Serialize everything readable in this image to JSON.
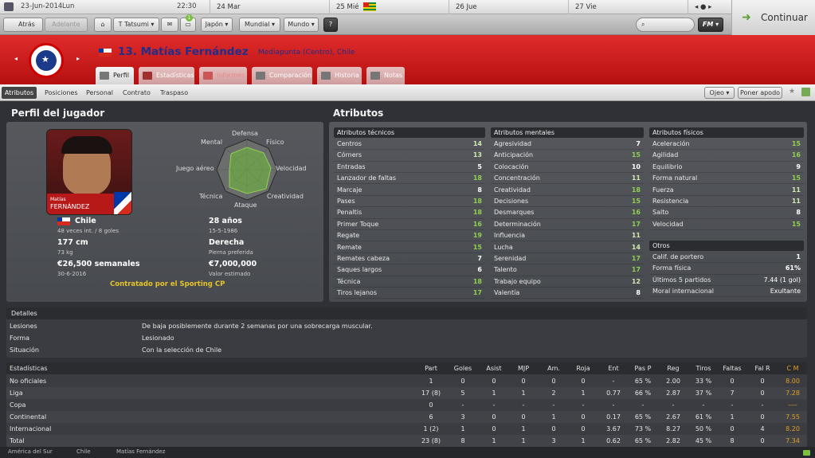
{
  "calendar": {
    "date": "23-Jun-2014",
    "day": "Lun",
    "time": "22:30",
    "d1": "24 Mar",
    "d2": "25 Mié",
    "d3": "26 Jue",
    "d4": "27 Vie"
  },
  "nav": {
    "back": "Atrás",
    "forward": "Adelante",
    "manager": "T Tatsumi",
    "menu1": "Japón",
    "menu2": "Mundial",
    "menu3": "Mundo",
    "help": "?",
    "search_placeholder": "",
    "fm": "FM",
    "continue": "Continuar",
    "notif": "1"
  },
  "player": {
    "title": "13. Matías Fernández",
    "position": "Mediapunta (Centro), Chile"
  },
  "tabs": [
    "Perfil",
    "Estadísticas",
    "Informes",
    "Comparación",
    "Historia",
    "Notas"
  ],
  "subtabs": [
    "Atributos",
    "Posiciones",
    "Personal",
    "Contrato",
    "Traspaso"
  ],
  "actions": {
    "scout": "Ojeo",
    "nick": "Poner apodo"
  },
  "profile": {
    "heading": "Perfil del jugador",
    "photo_first": "Matías",
    "photo_last": "FERNÁNDEZ",
    "nation": "Chile",
    "caps": "48 veces int. / 8 goles",
    "age": "28 años",
    "dob": "15-5-1986",
    "height": "177 cm",
    "weight": "73 kg",
    "foot": "Derecha",
    "foot_label": "Pierna preferida",
    "wage": "€26,500 semanales",
    "contract": "30-6-2016",
    "value": "€7,000,000",
    "value_label": "Valor estimado",
    "loan": "Contratado por el Sporting CP",
    "radar": {
      "defensa": "Defensa",
      "mental": "Mental",
      "fisico": "Físico",
      "aereo": "Juego aéreo",
      "velocidad": "Velocidad",
      "tecnica": "Técnica",
      "creatividad": "Creatividad",
      "ataque": "Ataque"
    }
  },
  "attributes": {
    "heading": "Atributos",
    "technical": {
      "title": "Atributos técnicos",
      "items": [
        [
          "Centros",
          "14"
        ],
        [
          "Córners",
          "13"
        ],
        [
          "Entradas",
          "5"
        ],
        [
          "Lanzador de faltas",
          "18"
        ],
        [
          "Marcaje",
          "8"
        ],
        [
          "Pases",
          "18"
        ],
        [
          "Penaltis",
          "18"
        ],
        [
          "Primer Toque",
          "16"
        ],
        [
          "Regate",
          "19"
        ],
        [
          "Remate",
          "15"
        ],
        [
          "Remates cabeza",
          "7"
        ],
        [
          "Saques largos",
          "6"
        ],
        [
          "Técnica",
          "18"
        ],
        [
          "Tiros lejanos",
          "17"
        ]
      ]
    },
    "mental": {
      "title": "Atributos mentales",
      "items": [
        [
          "Agresividad",
          "7"
        ],
        [
          "Anticipación",
          "15"
        ],
        [
          "Colocación",
          "10"
        ],
        [
          "Concentración",
          "11"
        ],
        [
          "Creatividad",
          "18"
        ],
        [
          "Decisiones",
          "15"
        ],
        [
          "Desmarques",
          "16"
        ],
        [
          "Determinación",
          "17"
        ],
        [
          "Influencia",
          "11"
        ],
        [
          "Lucha",
          "14"
        ],
        [
          "Serenidad",
          "17"
        ],
        [
          "Talento",
          "17"
        ],
        [
          "Trabajo equipo",
          "12"
        ],
        [
          "Valentía",
          "8"
        ]
      ]
    },
    "physical": {
      "title": "Atributos físicos",
      "items": [
        [
          "Aceleración",
          "15"
        ],
        [
          "Agilidad",
          "16"
        ],
        [
          "Equilibrio",
          "9"
        ],
        [
          "Forma natural",
          "15"
        ],
        [
          "Fuerza",
          "11"
        ],
        [
          "Resistencia",
          "11"
        ],
        [
          "Salto",
          "8"
        ],
        [
          "Velocidad",
          "15"
        ]
      ]
    },
    "others": {
      "title": "Otros",
      "items": [
        [
          "Calif. de portero",
          "1"
        ],
        [
          "Forma física",
          "61%"
        ],
        [
          "Últimos 5 partidos",
          "7.44 (1 gol)"
        ],
        [
          "Moral internacional",
          "Exultante"
        ]
      ]
    }
  },
  "details": {
    "title": "Detalles",
    "rows": [
      [
        "Lesiones",
        "De baja posiblemente durante 2 semanas por una sobrecarga muscular."
      ],
      [
        "Forma",
        "Lesionado"
      ],
      [
        "Situación",
        "Con la selección de Chile"
      ]
    ]
  },
  "stats": {
    "title": "Estadísticas",
    "cols": [
      "Part",
      "Goles",
      "Asist",
      "MJP",
      "Am.",
      "Roja",
      "Ent",
      "Pas P",
      "Reg",
      "Tiros",
      "Faltas",
      "Fal R",
      "C M"
    ],
    "rows": [
      [
        "No oficiales",
        "1",
        "0",
        "0",
        "0",
        "0",
        "0",
        "-",
        "65 %",
        "2.00",
        "33 %",
        "0",
        "0",
        "8.00"
      ],
      [
        "Liga",
        "17 (8)",
        "5",
        "1",
        "1",
        "2",
        "1",
        "0.77",
        "66 %",
        "2.87",
        "37 %",
        "7",
        "0",
        "7.28"
      ],
      [
        "Copa",
        "0",
        "-",
        "-",
        "-",
        "-",
        "-",
        "-",
        "-",
        "-",
        "-",
        "-",
        "-",
        "----"
      ],
      [
        "Continental",
        "6",
        "3",
        "0",
        "0",
        "1",
        "0",
        "0.17",
        "65 %",
        "2.67",
        "61 %",
        "1",
        "0",
        "7.55"
      ],
      [
        "Internacional",
        "1 (2)",
        "1",
        "0",
        "1",
        "0",
        "0",
        "3.67",
        "73 %",
        "8.27",
        "50 %",
        "0",
        "4",
        "8.20"
      ],
      [
        "Total",
        "23 (8)",
        "8",
        "1",
        "1",
        "3",
        "1",
        "0.62",
        "65 %",
        "2.82",
        "45 %",
        "8",
        "0",
        "7.34"
      ]
    ]
  },
  "breadcrumb": [
    "América del Sur",
    "Chile",
    "Matías Fernández"
  ]
}
